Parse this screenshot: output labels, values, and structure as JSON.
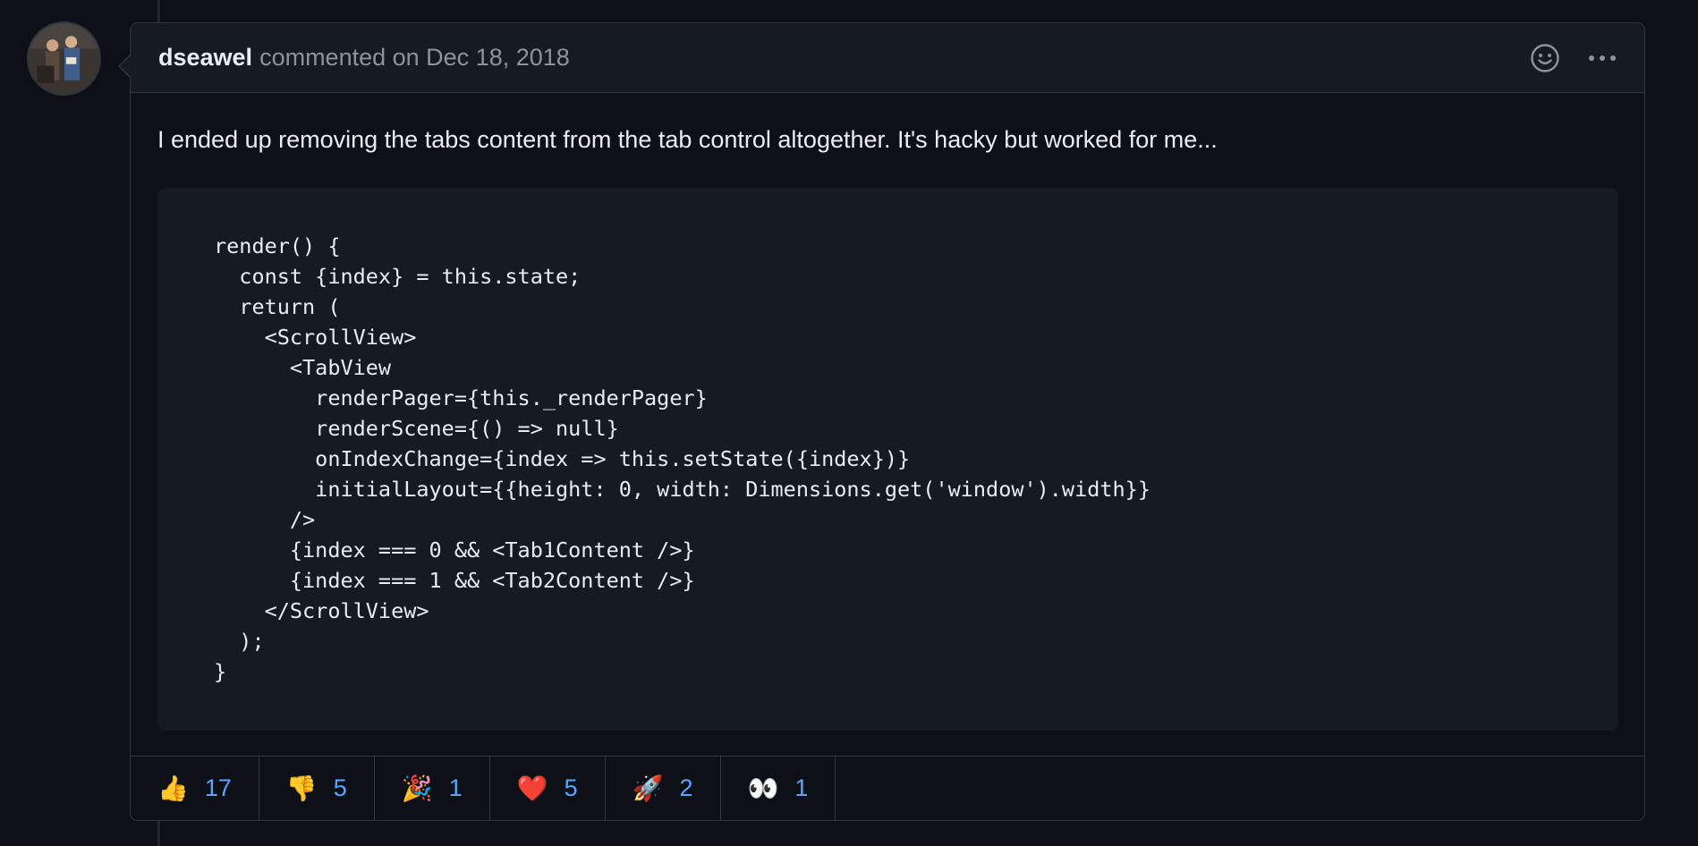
{
  "comment": {
    "author": "dseawel",
    "meta_text": "commented on Dec 18, 2018",
    "body": "I ended up removing the tabs content from the tab control altogether. It's hacky but worked for me...",
    "code": "render() {\n  const {index} = this.state;\n  return (\n    <ScrollView>\n      <TabView\n        renderPager={this._renderPager}\n        renderScene={() => null}\n        onIndexChange={index => this.setState({index})}\n        initialLayout={{height: 0, width: Dimensions.get('window').width}}\n      />\n      {index === 0 && <Tab1Content />}\n      {index === 1 && <Tab2Content />}\n    </ScrollView>\n  );\n}",
    "header_icons": [
      "smiley-icon",
      "kebab-horizontal-icon"
    ]
  },
  "reactions": [
    {
      "emoji": "👍",
      "count": "17",
      "name": "thumbs-up"
    },
    {
      "emoji": "👎",
      "count": "5",
      "name": "thumbs-down"
    },
    {
      "emoji": "🎉",
      "count": "1",
      "name": "hooray"
    },
    {
      "emoji": "❤️",
      "count": "5",
      "name": "heart"
    },
    {
      "emoji": "🚀",
      "count": "2",
      "name": "rocket"
    },
    {
      "emoji": "👀",
      "count": "1",
      "name": "eyes"
    }
  ],
  "colors": {
    "background": "#0d1117",
    "header": "#161b22",
    "border": "#30363d",
    "text": "#e6edf3",
    "muted": "#8b949e",
    "link": "#58a6ff"
  }
}
